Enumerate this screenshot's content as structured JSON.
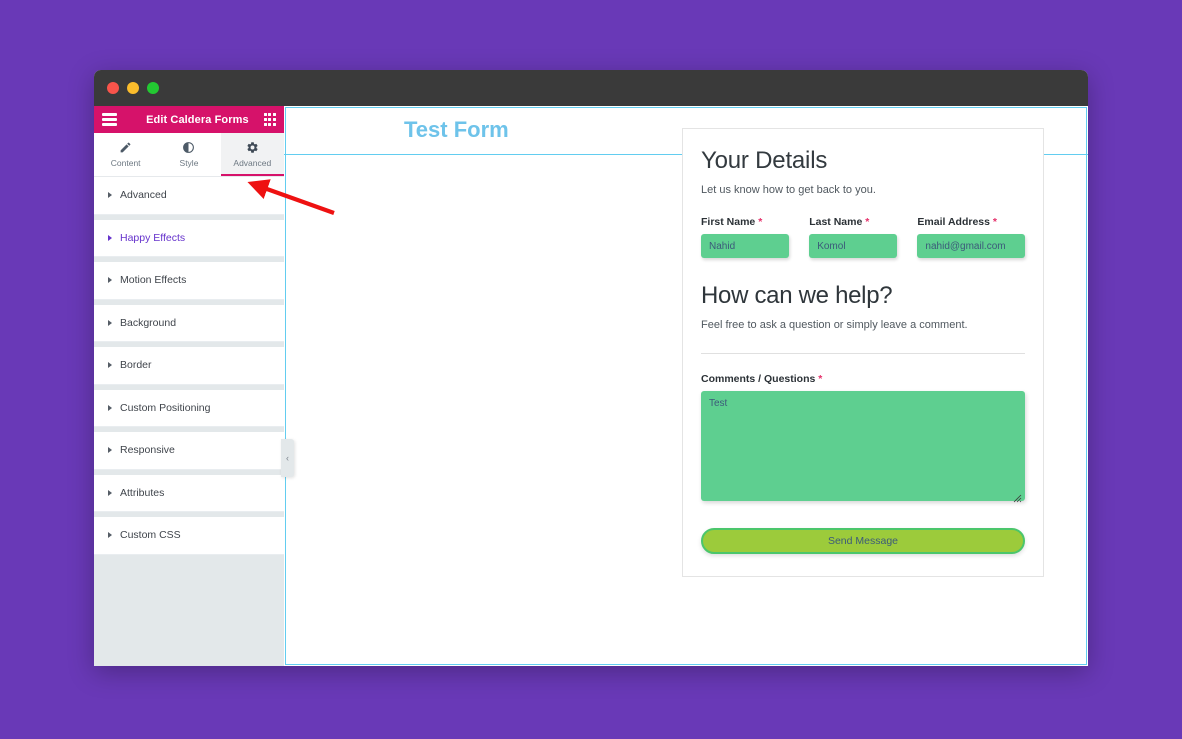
{
  "window": {
    "traffic_lights": [
      "close",
      "minimize",
      "maximize"
    ]
  },
  "panel": {
    "header": {
      "menu_icon": "hamburger-icon",
      "title": "Edit Caldera Forms",
      "grid_icon": "grid-icon"
    },
    "tabs": [
      {
        "label": "Content",
        "icon": "pencil-icon",
        "active": false
      },
      {
        "label": "Style",
        "icon": "contrast-icon",
        "active": false
      },
      {
        "label": "Advanced",
        "icon": "gear-icon",
        "active": true
      }
    ],
    "accordion": [
      {
        "label": "Advanced",
        "highlight": false
      },
      {
        "label": "Happy Effects",
        "highlight": true
      },
      {
        "label": "Motion Effects",
        "highlight": false
      },
      {
        "label": "Background",
        "highlight": false
      },
      {
        "label": "Border",
        "highlight": false
      },
      {
        "label": "Custom Positioning",
        "highlight": false
      },
      {
        "label": "Responsive",
        "highlight": false
      },
      {
        "label": "Attributes",
        "highlight": false
      },
      {
        "label": "Custom CSS",
        "highlight": false
      }
    ],
    "collapse_handle": "‹"
  },
  "canvas": {
    "page_title": "Test Form",
    "section_toolbar": {
      "add_icon": "plus-icon",
      "columns_icon": "columns-grid-icon",
      "duplicate_icon": "duplicate-icon",
      "remove_icon": "close-x-icon"
    }
  },
  "form": {
    "heading_details": "Your Details",
    "subtitle_details": "Let us know how to get back to you.",
    "fields": [
      {
        "label": "First Name",
        "required": "*",
        "value": "Nahid",
        "placeholder": "First Name"
      },
      {
        "label": "Last Name",
        "required": "*",
        "value": "Komol",
        "placeholder": "Last Name"
      },
      {
        "label": "Email Address",
        "required": "*",
        "value": "nahid@gmail.com",
        "placeholder": "Email Address"
      }
    ],
    "heading_help": "How can we help?",
    "subtitle_help": "Feel free to ask a question or simply leave a comment.",
    "comments": {
      "label": "Comments / Questions",
      "required": "*",
      "value": "Test",
      "placeholder": "Comments / Questions"
    },
    "submit_label": "Send Message"
  },
  "colors": {
    "desktop_background": "#6939b7",
    "panel_header": "#d6126a",
    "panel_background": "#e3e8ea",
    "active_tab_underline": "#d6126a",
    "highlight_accordion_text": "#6633cc",
    "section_highlight": "#62cdf0",
    "page_title": "#6ec3ea",
    "input_background": "#5ecf90",
    "submit_background": "#9ccb3b",
    "submit_border": "#4bc66b",
    "required_asterisk": "#e5306a",
    "annotation_arrow": "#ee1111"
  },
  "annotation": {
    "arrow": "red-arrow-pointing-to-advanced-tab"
  }
}
